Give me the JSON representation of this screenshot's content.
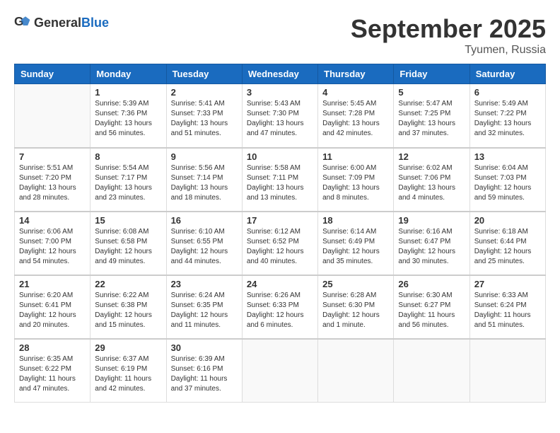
{
  "header": {
    "logo_general": "General",
    "logo_blue": "Blue",
    "month": "September 2025",
    "location": "Tyumen, Russia"
  },
  "days_of_week": [
    "Sunday",
    "Monday",
    "Tuesday",
    "Wednesday",
    "Thursday",
    "Friday",
    "Saturday"
  ],
  "weeks": [
    [
      {
        "day": "",
        "info": ""
      },
      {
        "day": "1",
        "info": "Sunrise: 5:39 AM\nSunset: 7:36 PM\nDaylight: 13 hours\nand 56 minutes."
      },
      {
        "day": "2",
        "info": "Sunrise: 5:41 AM\nSunset: 7:33 PM\nDaylight: 13 hours\nand 51 minutes."
      },
      {
        "day": "3",
        "info": "Sunrise: 5:43 AM\nSunset: 7:30 PM\nDaylight: 13 hours\nand 47 minutes."
      },
      {
        "day": "4",
        "info": "Sunrise: 5:45 AM\nSunset: 7:28 PM\nDaylight: 13 hours\nand 42 minutes."
      },
      {
        "day": "5",
        "info": "Sunrise: 5:47 AM\nSunset: 7:25 PM\nDaylight: 13 hours\nand 37 minutes."
      },
      {
        "day": "6",
        "info": "Sunrise: 5:49 AM\nSunset: 7:22 PM\nDaylight: 13 hours\nand 32 minutes."
      }
    ],
    [
      {
        "day": "7",
        "info": "Sunrise: 5:51 AM\nSunset: 7:20 PM\nDaylight: 13 hours\nand 28 minutes."
      },
      {
        "day": "8",
        "info": "Sunrise: 5:54 AM\nSunset: 7:17 PM\nDaylight: 13 hours\nand 23 minutes."
      },
      {
        "day": "9",
        "info": "Sunrise: 5:56 AM\nSunset: 7:14 PM\nDaylight: 13 hours\nand 18 minutes."
      },
      {
        "day": "10",
        "info": "Sunrise: 5:58 AM\nSunset: 7:11 PM\nDaylight: 13 hours\nand 13 minutes."
      },
      {
        "day": "11",
        "info": "Sunrise: 6:00 AM\nSunset: 7:09 PM\nDaylight: 13 hours\nand 8 minutes."
      },
      {
        "day": "12",
        "info": "Sunrise: 6:02 AM\nSunset: 7:06 PM\nDaylight: 13 hours\nand 4 minutes."
      },
      {
        "day": "13",
        "info": "Sunrise: 6:04 AM\nSunset: 7:03 PM\nDaylight: 12 hours\nand 59 minutes."
      }
    ],
    [
      {
        "day": "14",
        "info": "Sunrise: 6:06 AM\nSunset: 7:00 PM\nDaylight: 12 hours\nand 54 minutes."
      },
      {
        "day": "15",
        "info": "Sunrise: 6:08 AM\nSunset: 6:58 PM\nDaylight: 12 hours\nand 49 minutes."
      },
      {
        "day": "16",
        "info": "Sunrise: 6:10 AM\nSunset: 6:55 PM\nDaylight: 12 hours\nand 44 minutes."
      },
      {
        "day": "17",
        "info": "Sunrise: 6:12 AM\nSunset: 6:52 PM\nDaylight: 12 hours\nand 40 minutes."
      },
      {
        "day": "18",
        "info": "Sunrise: 6:14 AM\nSunset: 6:49 PM\nDaylight: 12 hours\nand 35 minutes."
      },
      {
        "day": "19",
        "info": "Sunrise: 6:16 AM\nSunset: 6:47 PM\nDaylight: 12 hours\nand 30 minutes."
      },
      {
        "day": "20",
        "info": "Sunrise: 6:18 AM\nSunset: 6:44 PM\nDaylight: 12 hours\nand 25 minutes."
      }
    ],
    [
      {
        "day": "21",
        "info": "Sunrise: 6:20 AM\nSunset: 6:41 PM\nDaylight: 12 hours\nand 20 minutes."
      },
      {
        "day": "22",
        "info": "Sunrise: 6:22 AM\nSunset: 6:38 PM\nDaylight: 12 hours\nand 15 minutes."
      },
      {
        "day": "23",
        "info": "Sunrise: 6:24 AM\nSunset: 6:35 PM\nDaylight: 12 hours\nand 11 minutes."
      },
      {
        "day": "24",
        "info": "Sunrise: 6:26 AM\nSunset: 6:33 PM\nDaylight: 12 hours\nand 6 minutes."
      },
      {
        "day": "25",
        "info": "Sunrise: 6:28 AM\nSunset: 6:30 PM\nDaylight: 12 hours\nand 1 minute."
      },
      {
        "day": "26",
        "info": "Sunrise: 6:30 AM\nSunset: 6:27 PM\nDaylight: 11 hours\nand 56 minutes."
      },
      {
        "day": "27",
        "info": "Sunrise: 6:33 AM\nSunset: 6:24 PM\nDaylight: 11 hours\nand 51 minutes."
      }
    ],
    [
      {
        "day": "28",
        "info": "Sunrise: 6:35 AM\nSunset: 6:22 PM\nDaylight: 11 hours\nand 47 minutes."
      },
      {
        "day": "29",
        "info": "Sunrise: 6:37 AM\nSunset: 6:19 PM\nDaylight: 11 hours\nand 42 minutes."
      },
      {
        "day": "30",
        "info": "Sunrise: 6:39 AM\nSunset: 6:16 PM\nDaylight: 11 hours\nand 37 minutes."
      },
      {
        "day": "",
        "info": ""
      },
      {
        "day": "",
        "info": ""
      },
      {
        "day": "",
        "info": ""
      },
      {
        "day": "",
        "info": ""
      }
    ]
  ]
}
